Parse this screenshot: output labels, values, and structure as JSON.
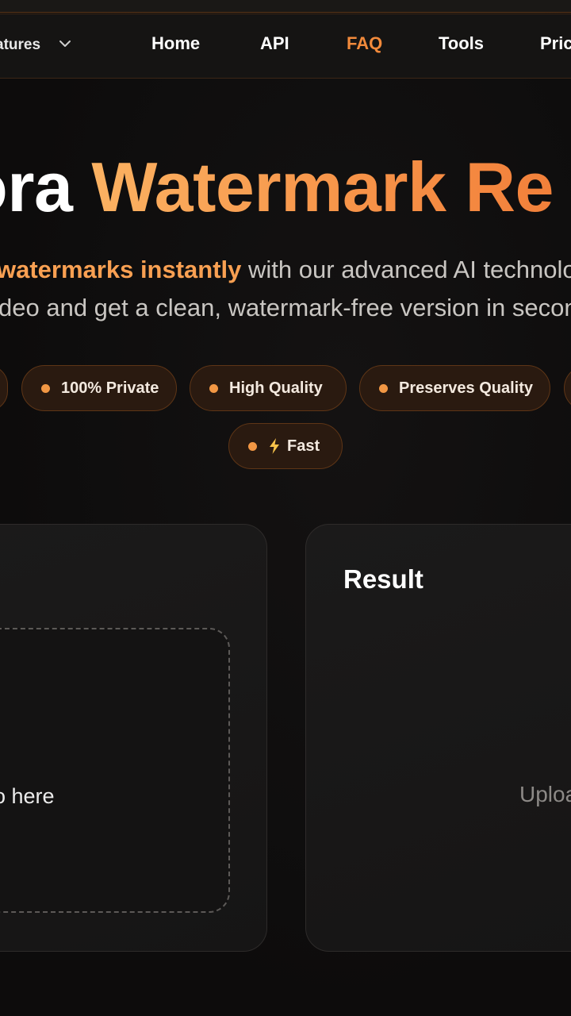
{
  "nav": {
    "features_label": "atures",
    "items": [
      {
        "label": "Home"
      },
      {
        "label": "API"
      },
      {
        "label": "FAQ",
        "active": true
      },
      {
        "label": "Tools"
      },
      {
        "label": "Pric"
      }
    ]
  },
  "hero": {
    "title_white": "ora ",
    "title_orange": "Watermark Re",
    "subtitle_line1_highlight": "watermarks instantly",
    "subtitle_line1_rest": " with our advanced AI technolog",
    "subtitle_line2": "deo and get a clean, watermark-free version in second"
  },
  "badges": [
    {
      "label": "100% Private"
    },
    {
      "label": "High Quality"
    },
    {
      "label": "Preserves Quality"
    },
    {
      "label": "Fast",
      "icon": "lightning-icon"
    }
  ],
  "upload_panel": {
    "dropzone_text": "o here"
  },
  "result_panel": {
    "title": "Result",
    "placeholder": "Uploa"
  },
  "colors": {
    "accent": "#f28a3b",
    "background": "#0e0d0d",
    "badge_bg": "#2a1a10",
    "badge_dot": "#f29744"
  }
}
